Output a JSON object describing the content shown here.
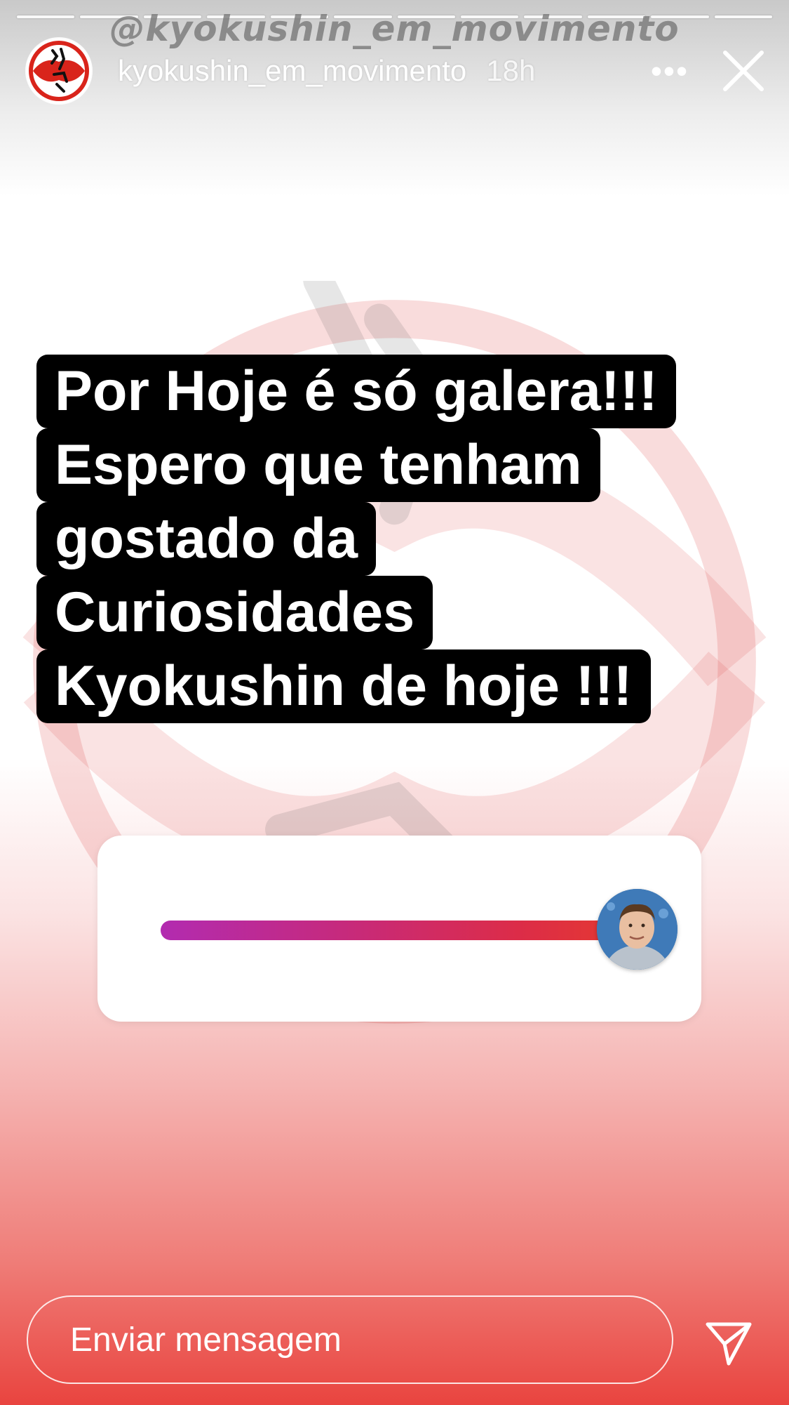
{
  "story": {
    "segments": 12,
    "watermark": "@kyokushin_em_movimento",
    "header": {
      "avatar_icon": "kyokushin-kanji-logo",
      "username": "kyokushin_em_movimento",
      "timestamp": "18h",
      "more_label": "•••",
      "close_icon": "close-icon"
    },
    "caption": [
      "Por Hoje é só galera!!!",
      "Espero que tenham",
      "gostado da",
      "Curiosidades",
      "Kyokushin de hoje !!!"
    ],
    "slider": {
      "value": 1.0,
      "emoji_icon": "person-photo",
      "gradient": [
        "#b22bb0",
        "#e63a2e"
      ]
    },
    "reply": {
      "placeholder": "Enviar mensagem",
      "send_icon": "send-icon"
    },
    "colors": {
      "accent_red": "#e9443f",
      "caption_bg": "#000000"
    }
  }
}
